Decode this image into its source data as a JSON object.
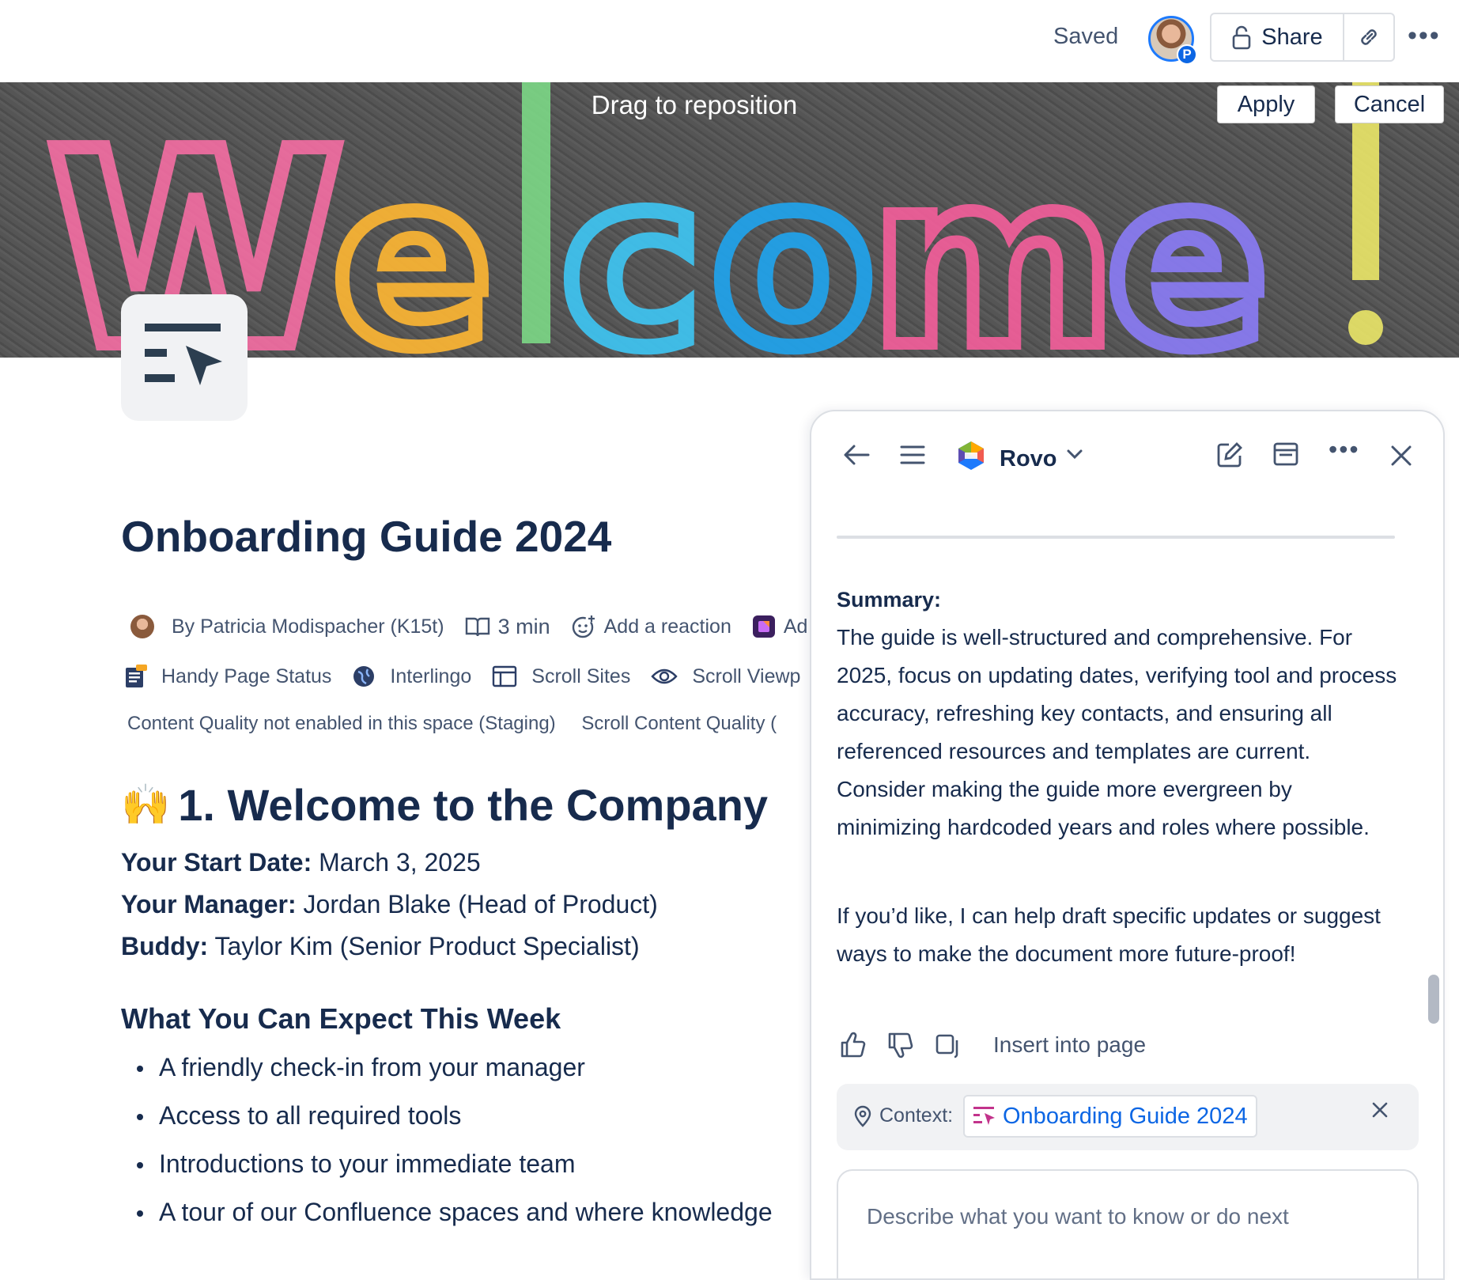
{
  "topbar": {
    "status": "Saved",
    "avatar_badge": "P",
    "share_label": "Share"
  },
  "banner": {
    "drag_label": "Drag to reposition",
    "apply_label": "Apply",
    "cancel_label": "Cancel",
    "image_text": "Welcome!"
  },
  "page": {
    "title": "Onboarding Guide 2024",
    "byline": {
      "author": "By Patricia Modispacher (K15t)",
      "read_time": "3 min",
      "reaction": "Add a reaction",
      "extra": "Ad"
    },
    "apps": [
      "Handy Page Status",
      "Interlingo",
      "Scroll Sites",
      "Scroll Viewp"
    ],
    "quality": [
      "Content Quality not enabled in this space (Staging)",
      "Scroll Content Quality ("
    ],
    "section": {
      "emoji": "🙌",
      "heading": "1. Welcome to the Company",
      "start_date_label": "Your Start Date:",
      "start_date_value": " March 3, 2025",
      "manager_label": "Your Manager:",
      "manager_value": " Jordan Blake (Head of Product)",
      "buddy_label": "Buddy:",
      "buddy_value": " Taylor Kim (Senior Product Specialist)",
      "subheading": "What You Can Expect This Week",
      "bullets": [
        "A friendly check-in from your manager",
        "Access to all required tools",
        "Introductions to your immediate team",
        "A tour of our Confluence spaces and where knowledge"
      ]
    }
  },
  "rovo_panel": {
    "agent_name": "Rovo",
    "summary_title": "Summary:",
    "summary_text": "The guide is well-structured and comprehensive. For 2025, focus on updating dates, verifying tool and process accuracy, refreshing key contacts, and ensuring all referenced resources and templates are current. Consider making the guide more evergreen by minimizing hardcoded years and roles where possible.",
    "followup_text": "If you’d like, I can help draft specific updates or suggest ways to make the document more future-proof!",
    "insert_label": "Insert into page",
    "context_label": "Context:",
    "context_page": "Onboarding Guide 2024",
    "prompt_placeholder": "Describe what you want to know or do next"
  },
  "colors": {
    "link": "#0c66e4",
    "text": "#172b4d",
    "subtle": "#44546f"
  }
}
